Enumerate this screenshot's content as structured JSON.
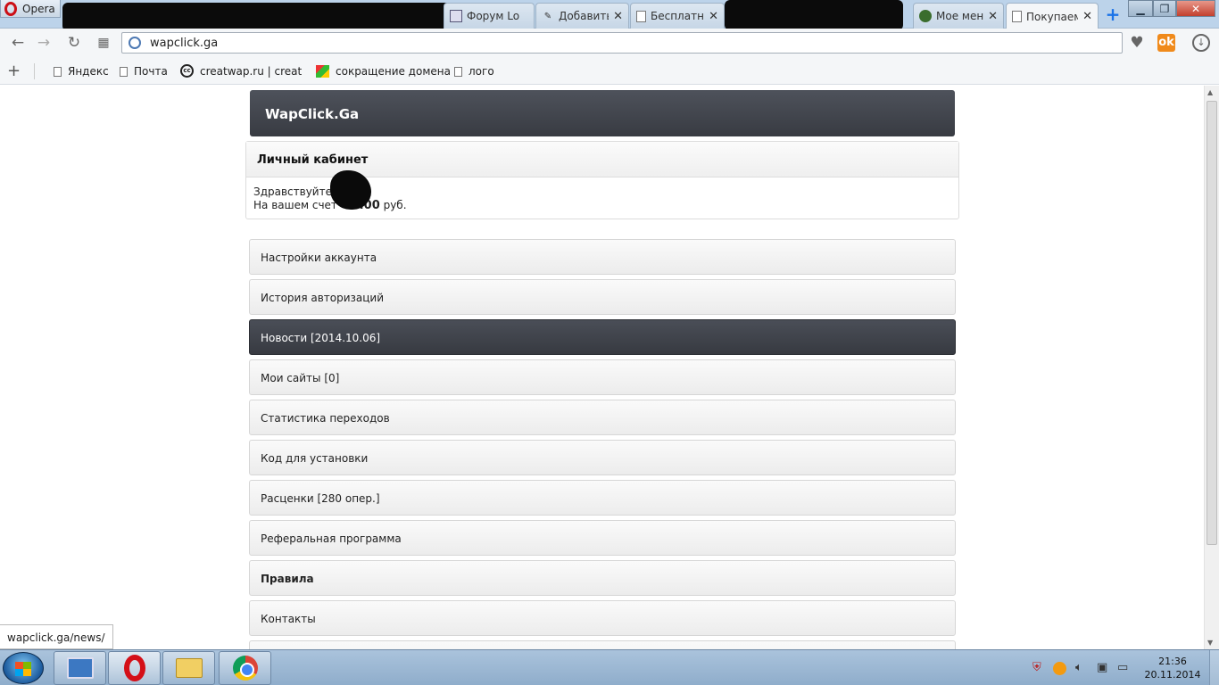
{
  "browser": {
    "menu_label": "Opera",
    "tabs": [
      {
        "title": "Форум Lo"
      },
      {
        "title": "Добавить"
      },
      {
        "title": "Бесплатн"
      },
      {
        "title": "Мое меню"
      },
      {
        "title": "Покупаем"
      }
    ],
    "tab_close": "✕",
    "new_tab": "+",
    "window_controls": {
      "minimize": "▁",
      "restore": "❐",
      "close": "✕"
    },
    "address": "wapclick.ga",
    "bookmarks": [
      {
        "label": "Яндекс"
      },
      {
        "label": "Почта"
      },
      {
        "label": "creatwap.ru | creatwa"
      },
      {
        "label": "сокращение домена"
      },
      {
        "label": "лого"
      }
    ],
    "status_url": "wapclick.ga/news/"
  },
  "site": {
    "brand": "WapClick.Ga",
    "cabinet": {
      "title": "Личный кабинет",
      "greeting": "Здравствуйте,",
      "balance_prefix": "На вашем счет",
      "balance_value": ".00",
      "balance_suffix": "руб."
    },
    "menu": [
      {
        "label": "Настройки аккаунта"
      },
      {
        "label": "История авторизаций"
      },
      {
        "label": "Новости [2014.10.06]"
      },
      {
        "label": "Мои сайты [0]"
      },
      {
        "label": "Статистика переходов"
      },
      {
        "label": "Код для установки"
      },
      {
        "label": "Расценки [280 опер.]"
      },
      {
        "label": "Реферальная программа"
      },
      {
        "label": "Правила"
      },
      {
        "label": "Контакты"
      }
    ]
  },
  "taskbar": {
    "time": "21:36",
    "date": "20.11.2014"
  },
  "colors": {
    "header_dark": "#3c3f46",
    "tabstrip": "#bcd3ea",
    "taskbar": "#9bb7d3"
  }
}
